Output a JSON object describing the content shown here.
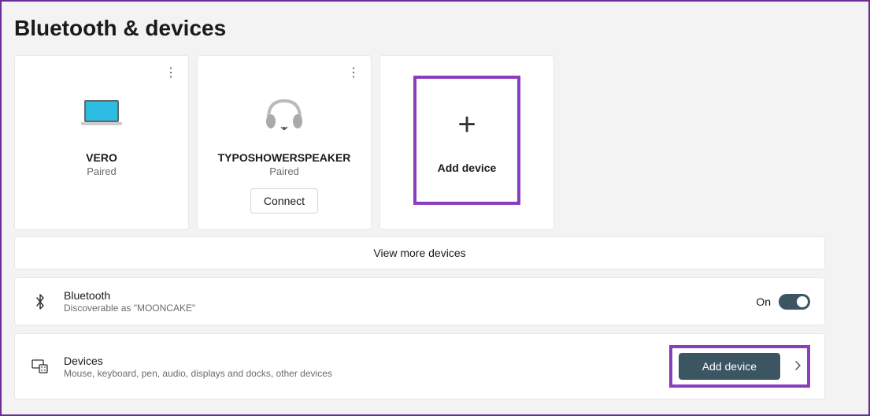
{
  "page": {
    "title": "Bluetooth & devices"
  },
  "devices": [
    {
      "name": "VERO",
      "status": "Paired",
      "icon": "laptop",
      "has_connect": false
    },
    {
      "name": "TYPOSHOWERSPEAKER",
      "status": "Paired",
      "icon": "headphones",
      "has_connect": true,
      "connect_label": "Connect"
    }
  ],
  "add_card": {
    "label": "Add device"
  },
  "view_more": {
    "label": "View more devices"
  },
  "bluetooth_row": {
    "title": "Bluetooth",
    "subtitle": "Discoverable as \"MOONCAKE\"",
    "toggle_state": "On"
  },
  "devices_row": {
    "title": "Devices",
    "subtitle": "Mouse, keyboard, pen, audio, displays and docks, other devices",
    "button_label": "Add device"
  }
}
